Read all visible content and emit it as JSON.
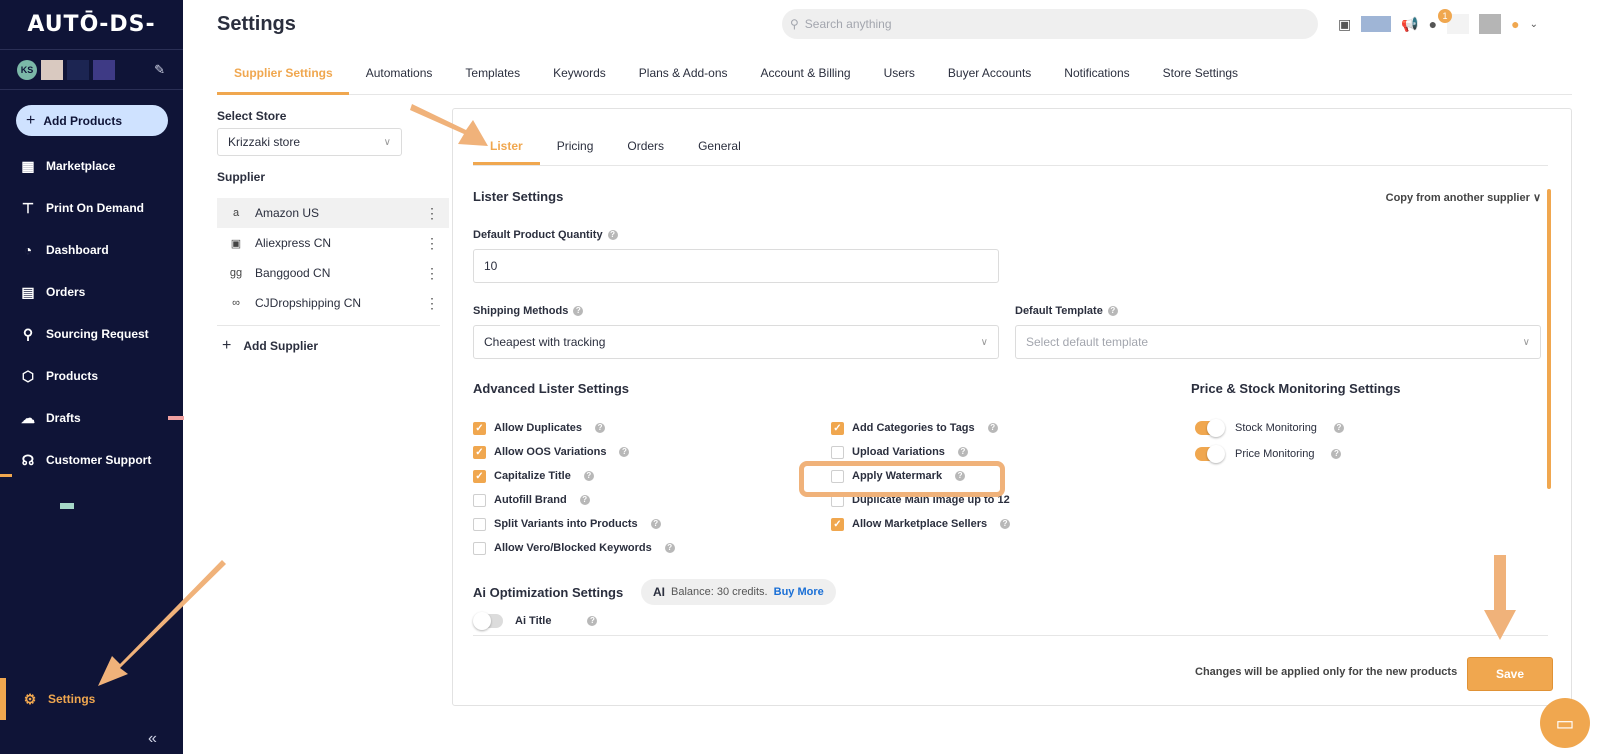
{
  "app": {
    "logo": "AUTŌ-DS-",
    "page_title": "Settings"
  },
  "header": {
    "search_placeholder": "Search anything",
    "notification_count": "1"
  },
  "account": {
    "initials": "KS"
  },
  "sidebar": {
    "add_products": "Add Products",
    "items": [
      {
        "label": "Marketplace",
        "icon": "store-icon"
      },
      {
        "label": "Print On Demand",
        "icon": "shirt-icon"
      },
      {
        "label": "Dashboard",
        "icon": "gauge-icon"
      },
      {
        "label": "Orders",
        "icon": "orders-icon"
      },
      {
        "label": "Sourcing Request",
        "icon": "sourcing-icon"
      },
      {
        "label": "Products",
        "icon": "box-icon"
      },
      {
        "label": "Drafts",
        "icon": "upload-cloud-icon"
      },
      {
        "label": "Customer Support",
        "icon": "headset-icon"
      }
    ],
    "settings": "Settings"
  },
  "top_tabs": [
    "Supplier Settings",
    "Automations",
    "Templates",
    "Keywords",
    "Plans & Add-ons",
    "Account & Billing",
    "Users",
    "Buyer Accounts",
    "Notifications",
    "Store Settings"
  ],
  "left_panel": {
    "select_store_label": "Select Store",
    "store_value": "Krizzaki store",
    "supplier_label": "Supplier",
    "suppliers": [
      {
        "name": "Amazon US",
        "icon": "a"
      },
      {
        "name": "Aliexpress CN",
        "icon": "▣"
      },
      {
        "name": "Banggood CN",
        "icon": "gg"
      },
      {
        "name": "CJDropshipping CN",
        "icon": "∞"
      }
    ],
    "add_supplier": "Add Supplier"
  },
  "sub_tabs": [
    "Lister",
    "Pricing",
    "Orders",
    "General"
  ],
  "lister": {
    "title": "Lister Settings",
    "copy_link": "Copy from another supplier",
    "quantity_label": "Default Product Quantity",
    "quantity_value": "10",
    "shipping_label": "Shipping Methods",
    "shipping_value": "Cheapest with tracking",
    "template_label": "Default Template",
    "template_placeholder": "Select default template",
    "advanced_title": "Advanced Lister Settings",
    "col1": [
      {
        "label": "Allow Duplicates",
        "checked": true
      },
      {
        "label": "Allow OOS Variations",
        "checked": true
      },
      {
        "label": "Capitalize Title",
        "checked": true
      },
      {
        "label": "Autofill Brand",
        "checked": false
      },
      {
        "label": "Split Variants into Products",
        "checked": false
      },
      {
        "label": "Allow Vero/Blocked Keywords",
        "checked": false
      }
    ],
    "col2": [
      {
        "label": "Add Categories to Tags",
        "checked": true
      },
      {
        "label": "Upload Variations",
        "checked": false
      },
      {
        "label": "Apply Watermark",
        "checked": false
      },
      {
        "label": "Duplicate Main Image up to 12",
        "checked": false
      },
      {
        "label": "Allow Marketplace Sellers",
        "checked": true
      }
    ],
    "monitoring_title": "Price & Stock Monitoring Settings",
    "monitoring": [
      {
        "label": "Stock Monitoring",
        "on": true
      },
      {
        "label": "Price Monitoring",
        "on": true
      }
    ],
    "ai_title": "Ai Optimization Settings",
    "ai_mark": "AI",
    "balance_text": "Balance: 30 credits.",
    "buy_more": "Buy More",
    "ai_title_toggle": {
      "label": "Ai Title",
      "on": false
    },
    "footer_note": "Changes will be applied only for the new products",
    "save": "Save"
  },
  "colors": {
    "accent": "#f0a74f",
    "sidebar_bg": "#0f1437",
    "link": "#1a6fd6"
  }
}
